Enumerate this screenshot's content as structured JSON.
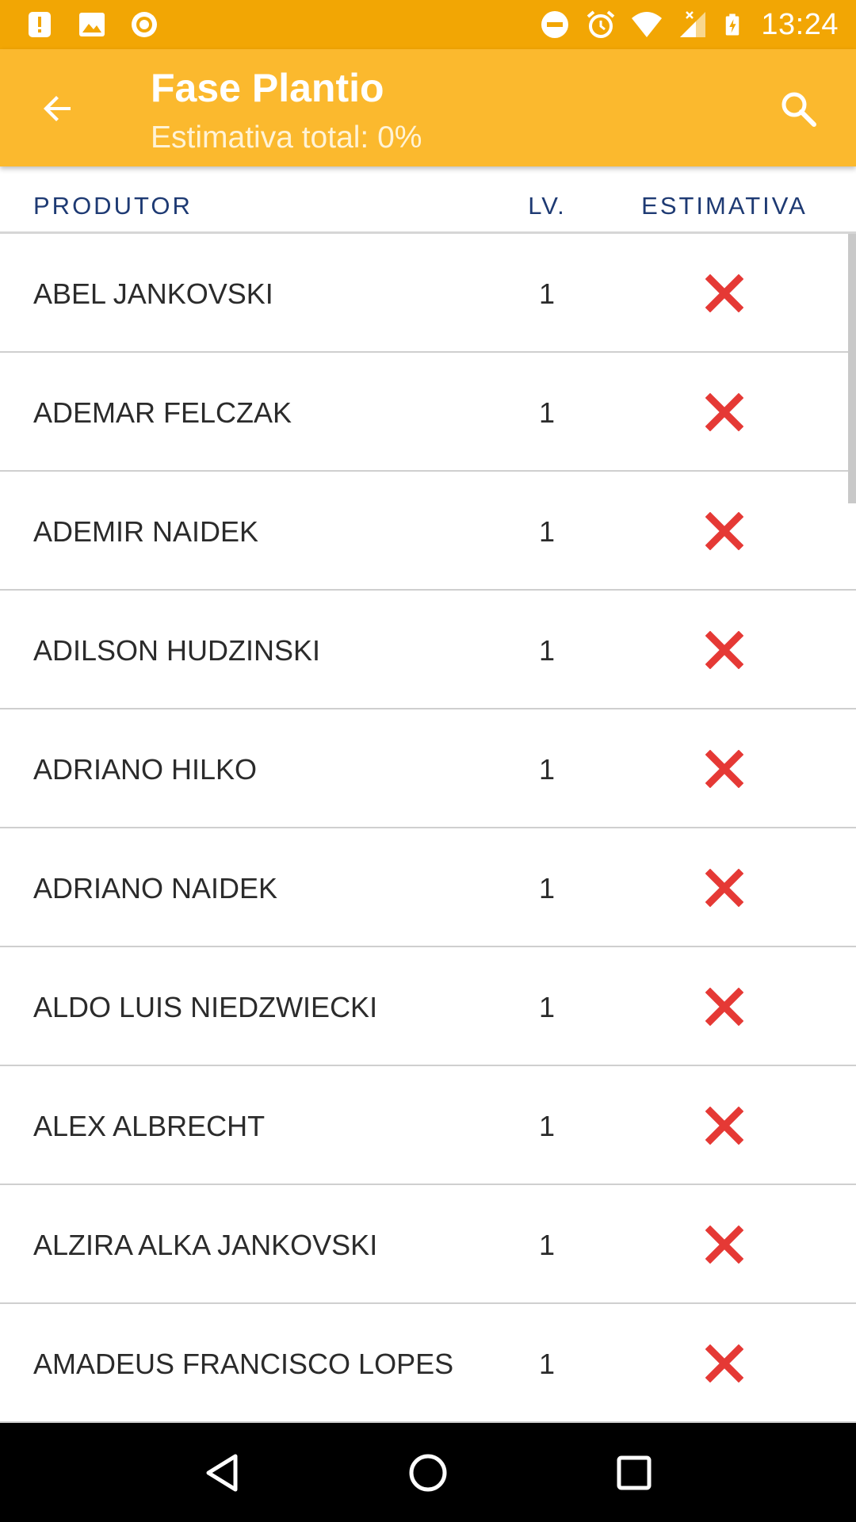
{
  "status_bar": {
    "time": "13:24",
    "icons_left": [
      "alert-notification-icon",
      "image-notification-icon",
      "record-notification-icon"
    ],
    "icons_right": [
      "do-not-disturb-icon",
      "alarm-icon",
      "wifi-icon",
      "cell-signal-icon",
      "battery-charging-icon"
    ]
  },
  "app_bar": {
    "title": "Fase Plantio",
    "subtitle": "Estimativa total: 0%",
    "background": "#fbb92e"
  },
  "table": {
    "headers": {
      "produtor": "PRODUTOR",
      "lv": "LV.",
      "estimativa": "ESTIMATIVA"
    },
    "rows": [
      {
        "name": "ABEL JANKOVSKI",
        "lv": "1",
        "estimativa": "x-mark-icon"
      },
      {
        "name": "ADEMAR FELCZAK",
        "lv": "1",
        "estimativa": "x-mark-icon"
      },
      {
        "name": "ADEMIR NAIDEK",
        "lv": "1",
        "estimativa": "x-mark-icon"
      },
      {
        "name": "ADILSON HUDZINSKI",
        "lv": "1",
        "estimativa": "x-mark-icon"
      },
      {
        "name": "ADRIANO HILKO",
        "lv": "1",
        "estimativa": "x-mark-icon"
      },
      {
        "name": "ADRIANO NAIDEK",
        "lv": "1",
        "estimativa": "x-mark-icon"
      },
      {
        "name": "ALDO LUIS NIEDZWIECKI",
        "lv": "1",
        "estimativa": "x-mark-icon"
      },
      {
        "name": "ALEX ALBRECHT",
        "lv": "1",
        "estimativa": "x-mark-icon"
      },
      {
        "name": "ALZIRA ALKA JANKOVSKI",
        "lv": "1",
        "estimativa": "x-mark-icon"
      },
      {
        "name": "AMADEUS FRANCISCO LOPES",
        "lv": "1",
        "estimativa": "x-mark-icon"
      }
    ]
  },
  "colors": {
    "status_bar": "#f2a604",
    "header_text": "#1e3a73",
    "x_mark": "#e53935"
  },
  "nav_bar": {
    "buttons": [
      "back-triangle-icon",
      "home-circle-icon",
      "recents-square-icon"
    ]
  }
}
